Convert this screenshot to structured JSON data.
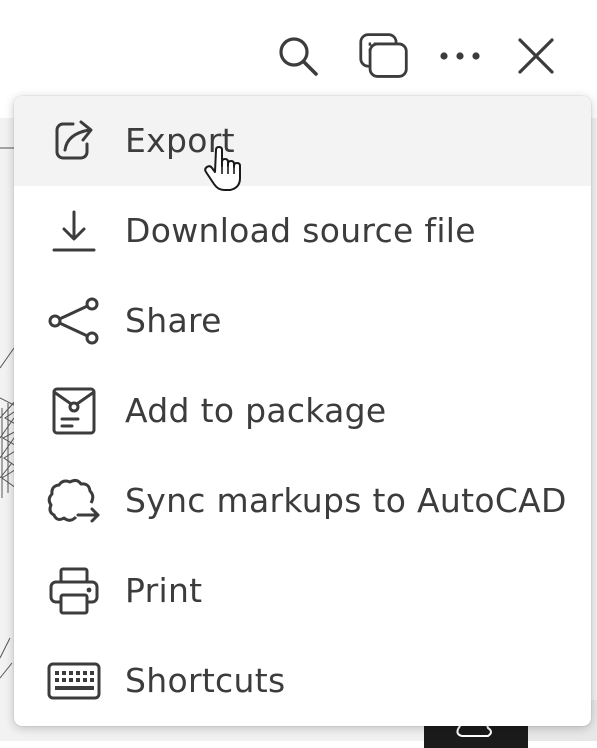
{
  "toolbar": {
    "buttons": [
      {
        "name": "search-icon"
      },
      {
        "name": "compare-sheets-icon"
      },
      {
        "name": "more-options-icon"
      },
      {
        "name": "close-icon"
      }
    ]
  },
  "menu": {
    "items": [
      {
        "label": "Export",
        "icon": "export-icon"
      },
      {
        "label": "Download source file",
        "icon": "download-icon"
      },
      {
        "label": "Share",
        "icon": "share-icon"
      },
      {
        "label": "Add to package",
        "icon": "package-icon"
      },
      {
        "label": "Sync markups to AutoCAD",
        "icon": "sync-markups-icon"
      },
      {
        "label": "Print",
        "icon": "printer-icon"
      },
      {
        "label": "Shortcuts",
        "icon": "keyboard-icon"
      }
    ]
  },
  "colors": {
    "icon": "#3c3c3c",
    "text": "#3c3c3c",
    "hover": "#f3f3f3",
    "menu_bg": "#ffffff"
  }
}
